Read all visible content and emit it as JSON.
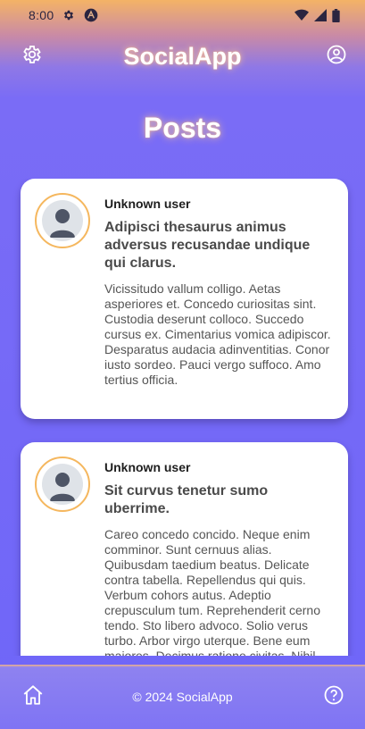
{
  "status_bar": {
    "time": "8:00",
    "left_icons": [
      "gear-icon",
      "a-icon"
    ],
    "right_icons": [
      "wifi-icon",
      "signal-icon",
      "battery-icon"
    ]
  },
  "app_bar": {
    "title": "SocialApp",
    "left_icon": "settings-icon",
    "right_icon": "account-icon"
  },
  "page": {
    "heading": "Posts"
  },
  "posts": [
    {
      "author": "Unknown user",
      "title": "Adipisci thesaurus animus adversus recusandae undique qui clarus.",
      "body": "Vicissitudo vallum colligo. Aetas asperiores et. Concedo curiositas sint. Custodia deserunt colloco. Succedo cursus ex. Cimentarius vomica adipiscor. Desparatus audacia adinventitias. Conor iusto sordeo. Pauci vergo suffoco. Amo tertius officia."
    },
    {
      "author": "Unknown user",
      "title": "Sit curvus tenetur sumo uberrime.",
      "body": "Careo concedo concido. Neque enim comminor. Sunt cernuus alias. Quibusdam taedium beatus. Delicate contra tabella. Repellendus qui quis. Verbum cohors autus. Adeptio crepusculum tum. Reprehenderit cerno tendo. Sto libero advoco. Solio verus turbo. Arbor virgo uterque. Bene eum maiores. Decimus ratione civitas. Nihil"
    }
  ],
  "footer": {
    "text": "© 2024 SocialApp",
    "left_icon": "home-icon",
    "right_icon": "help-icon"
  },
  "colors": {
    "accent_orange": "#f5b75e",
    "primary_purple": "#6f66f8",
    "card_bg": "#ffffff"
  }
}
